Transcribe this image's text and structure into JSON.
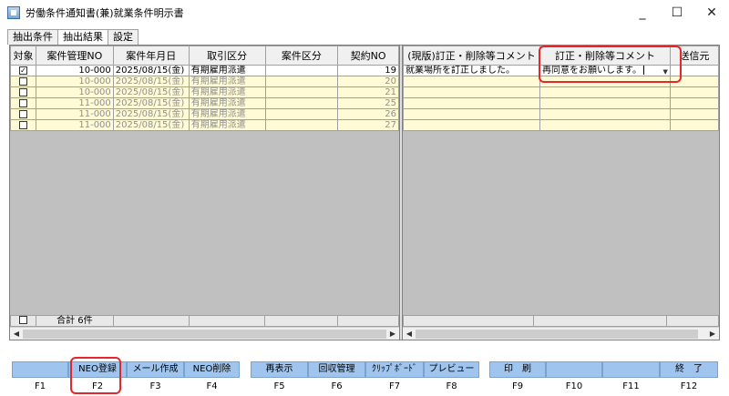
{
  "window": {
    "title": "労働条件通知書(兼)就業条件明示書",
    "icon": "app-document-icon",
    "controls": [
      "_",
      "☐",
      "✕"
    ]
  },
  "tabs": [
    "抽出条件",
    "抽出結果",
    "設定"
  ],
  "left_grid": {
    "headers": [
      "対象",
      "案件管理NO",
      "案件年月日",
      "取引区分",
      "案件区分",
      "契約NO"
    ],
    "rows": [
      {
        "checked": true,
        "mgmt_no": "10-000",
        "date": "2025/08/15(金)",
        "trade": "有期雇用派遣",
        "case": "",
        "contract": "19"
      },
      {
        "checked": false,
        "mgmt_no": "10-000",
        "date": "2025/08/15(金)",
        "trade": "有期雇用派遣",
        "case": "",
        "contract": "20"
      },
      {
        "checked": false,
        "mgmt_no": "10-000",
        "date": "2025/08/15(金)",
        "trade": "有期雇用派遣",
        "case": "",
        "contract": "21"
      },
      {
        "checked": false,
        "mgmt_no": "11-000",
        "date": "2025/08/15(金)",
        "trade": "有期雇用派遣",
        "case": "",
        "contract": "25"
      },
      {
        "checked": false,
        "mgmt_no": "11-000",
        "date": "2025/08/15(金)",
        "trade": "有期雇用派遣",
        "case": "",
        "contract": "26"
      },
      {
        "checked": false,
        "mgmt_no": "11-000",
        "date": "2025/08/15(金)",
        "trade": "有期雇用派遣",
        "case": "",
        "contract": "27"
      }
    ],
    "total_label": "合計",
    "total_count": "6件"
  },
  "right_grid": {
    "headers": [
      "(現版)訂正・削除等コメント",
      "訂正・削除等コメント",
      "送信元"
    ],
    "rows": [
      {
        "current_comment": "就業場所を訂正しました。",
        "comment": "再同意をお願いします。"
      },
      {
        "current_comment": "",
        "comment": ""
      },
      {
        "current_comment": "",
        "comment": ""
      },
      {
        "current_comment": "",
        "comment": ""
      },
      {
        "current_comment": "",
        "comment": ""
      },
      {
        "current_comment": "",
        "comment": ""
      }
    ]
  },
  "function_keys": [
    {
      "key": "F1",
      "label": ""
    },
    {
      "key": "F2",
      "label": "NEO登録"
    },
    {
      "key": "F3",
      "label": "メール作成"
    },
    {
      "key": "F4",
      "label": "NEO削除"
    },
    {
      "key": "F5",
      "label": "再表示"
    },
    {
      "key": "F6",
      "label": "回収管理"
    },
    {
      "key": "F7",
      "label": "ｸﾘｯﾌﾟﾎﾞｰﾄﾞ"
    },
    {
      "key": "F8",
      "label": "プレビュー"
    },
    {
      "key": "F9",
      "label": "印　刷"
    },
    {
      "key": "F10",
      "label": ""
    },
    {
      "key": "F11",
      "label": ""
    },
    {
      "key": "F12",
      "label": "終　了"
    }
  ],
  "colors": {
    "highlight": "#e5262b",
    "fkey_bg": "#9fc5ee",
    "dim_row_bg": "#fffbd6"
  }
}
